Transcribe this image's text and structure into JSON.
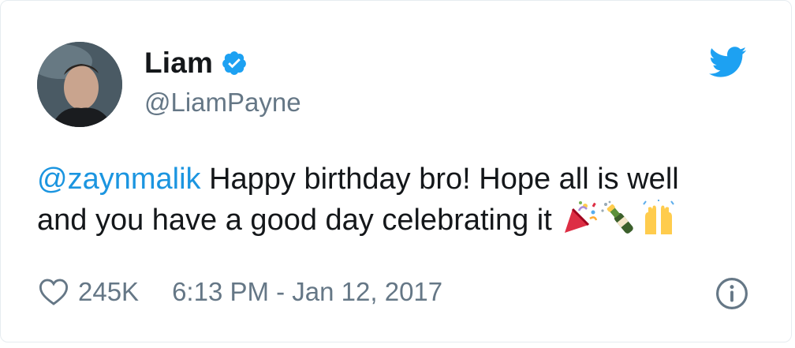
{
  "user": {
    "display_name": "Liam",
    "handle": "@LiamPayne",
    "verified": true
  },
  "tweet": {
    "mention": "@zaynmalik",
    "text_line1_rest": " Happy birthday bro! Hope all is well",
    "text_line2": "and you have a good day celebrating it",
    "emojis": [
      "party-popper-icon",
      "champagne-icon",
      "raised-hands-icon"
    ]
  },
  "meta": {
    "likes": "245K",
    "timestamp": "6:13 PM - Jan 12, 2017"
  },
  "colors": {
    "twitter_blue": "#1da1f2",
    "mention_blue": "#1b95e0",
    "secondary_text": "#657786",
    "primary_text": "#14171a"
  }
}
